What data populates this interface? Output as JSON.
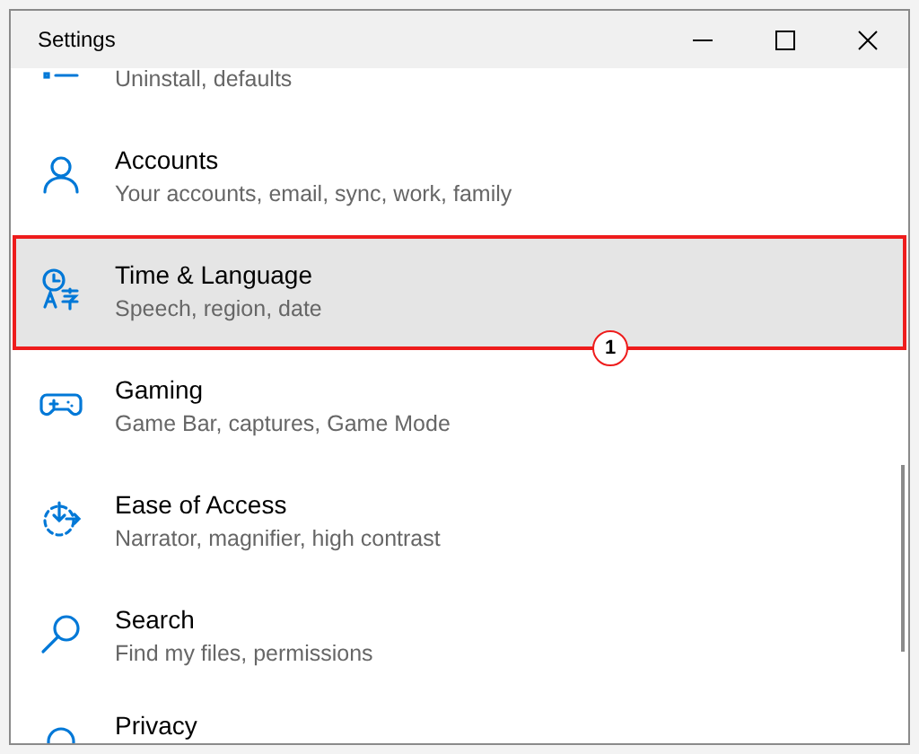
{
  "window": {
    "title": "Settings"
  },
  "items": [
    {
      "kind": "apps",
      "subtitle": "Uninstall, defaults",
      "selected": false
    },
    {
      "kind": "accounts",
      "title": "Accounts",
      "subtitle": "Your accounts, email, sync, work, family",
      "selected": false
    },
    {
      "kind": "time",
      "title": "Time & Language",
      "subtitle": "Speech, region, date",
      "selected": true,
      "callout": "1"
    },
    {
      "kind": "gaming",
      "title": "Gaming",
      "subtitle": "Game Bar, captures, Game Mode",
      "selected": false
    },
    {
      "kind": "ease",
      "title": "Ease of Access",
      "subtitle": "Narrator, magnifier, high contrast",
      "selected": false
    },
    {
      "kind": "search",
      "title": "Search",
      "subtitle": "Find my files, permissions",
      "selected": false
    },
    {
      "kind": "privacy",
      "title": "Privacy",
      "selected": false
    }
  ]
}
